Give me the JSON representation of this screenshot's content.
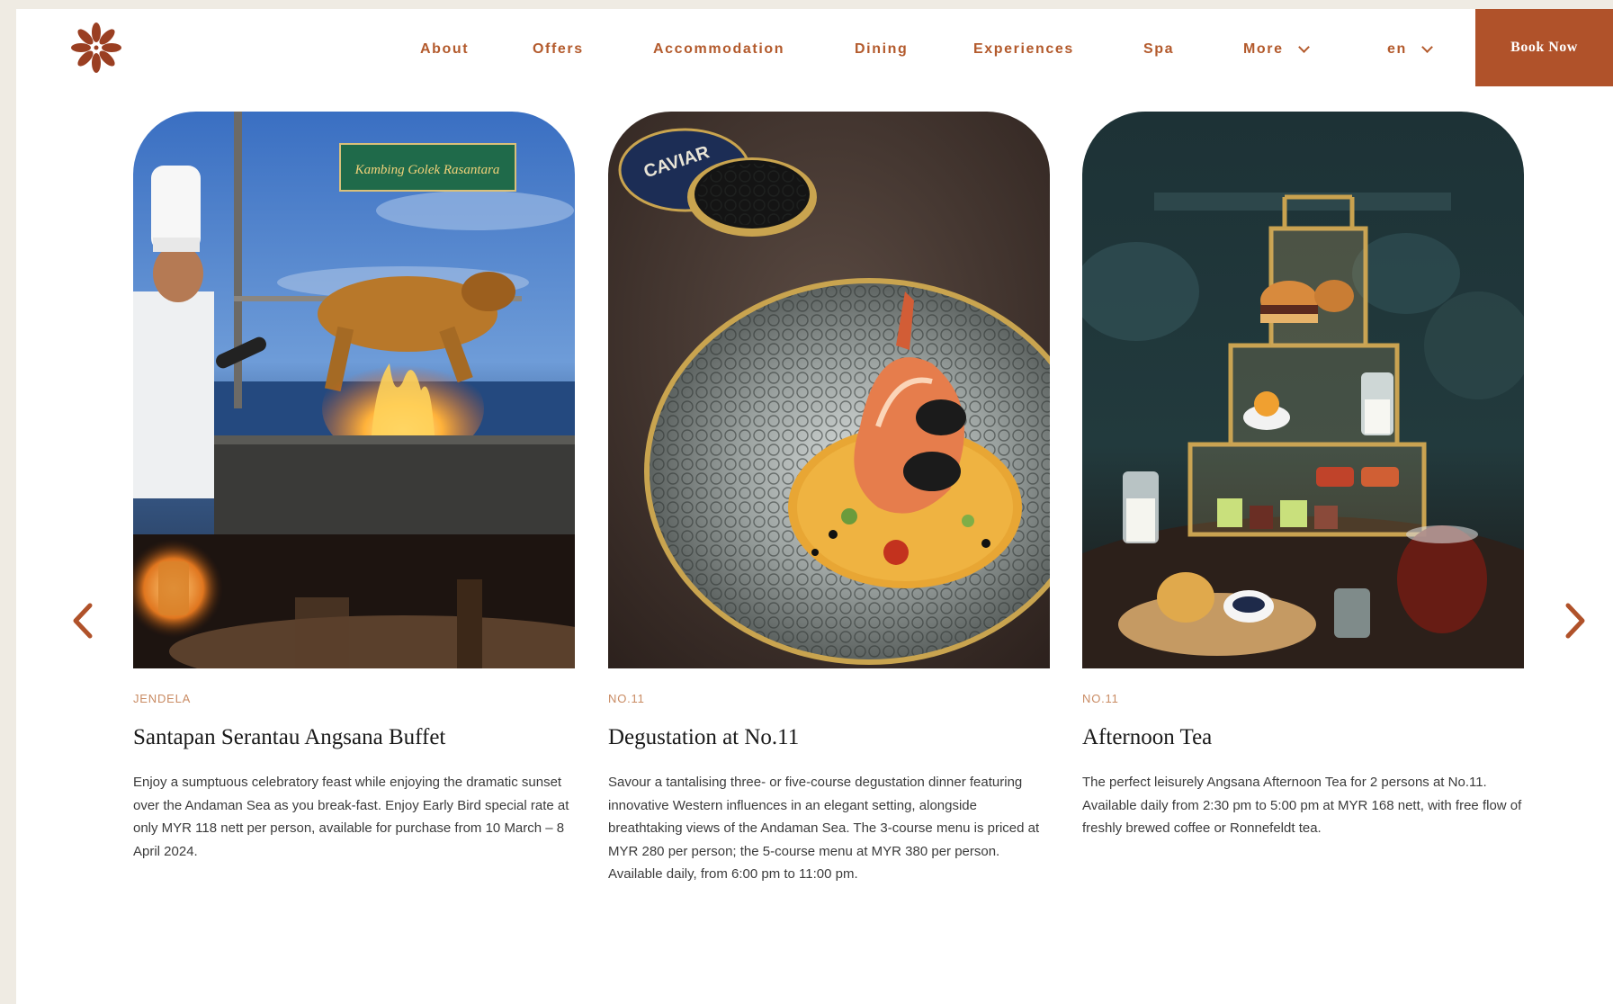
{
  "nav": {
    "items": [
      {
        "label": "About"
      },
      {
        "label": "Offers"
      },
      {
        "label": "Accommodation"
      },
      {
        "label": "Dining"
      },
      {
        "label": "Experiences"
      },
      {
        "label": "Spa"
      },
      {
        "label": "More"
      },
      {
        "label": "en"
      }
    ],
    "book_label": "Book Now"
  },
  "colors": {
    "accent": "#b0522a",
    "venue_label": "#c98b63",
    "page_bg": "#efebe3"
  },
  "icons": {
    "logo": "flower-logo-icon",
    "prev": "chevron-left-icon",
    "next": "chevron-right-icon",
    "dropdown": "chevron-down-icon"
  },
  "cards": [
    {
      "venue": "JENDELA",
      "title": "Santapan Serantau Angsana Buffet",
      "description": "Enjoy a sumptuous celebratory feast while enjoying the dramatic sunset over the Andaman Sea as you break-fast. Enjoy Early Bird special rate at only MYR 118 nett per person, available for purchase from 10 March – 8 April 2024.",
      "sign_text": "Kambing Golek Rasantara"
    },
    {
      "venue": "NO.11",
      "title": "Degustation at No.11",
      "description": "Savour a tantalising three- or five-course degustation dinner featuring innovative Western influences in an elegant setting, alongside breathtaking views of the Andaman Sea. The 3-course menu is priced at MYR 280 per person; the 5-course menu at MYR 380 per person. Available daily, from 6:00 pm to 11:00 pm.",
      "tin_text": "CAVIAR"
    },
    {
      "venue": "NO.11",
      "title": "Afternoon Tea",
      "description": "The perfect leisurely Angsana Afternoon Tea for 2 persons at No.11. Available daily from 2:30 pm to 5:00 pm at MYR 168 nett, with free flow of freshly brewed coffee or Ronnefeldt tea."
    }
  ]
}
